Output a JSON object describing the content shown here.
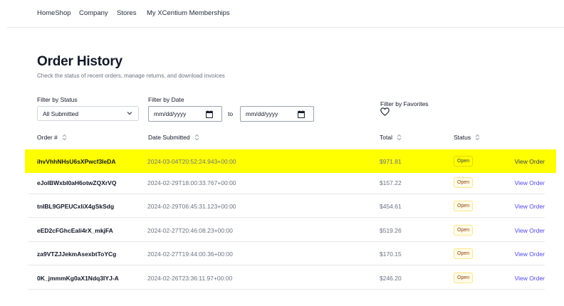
{
  "nav": {
    "items": [
      {
        "label": "HomeShop"
      },
      {
        "label": "Company"
      },
      {
        "label": "Stores"
      },
      {
        "label": "My XCentium Memberships"
      }
    ]
  },
  "header": {
    "title": "Order History",
    "subtitle": "Check the status of recent orders, manage returns, and download invoices"
  },
  "filters": {
    "status_label": "Filter by Status",
    "status_value": "All Submitted",
    "date_label": "Filter by Date",
    "date_from_placeholder": "mm/dd/yyyy",
    "date_to_placeholder": "mm/dd/yyyy",
    "to_label": "to",
    "favorites_label": "Filter by Favorites"
  },
  "table": {
    "columns": {
      "order": "Order #",
      "date": "Date Submitted",
      "total": "Total",
      "status": "Status"
    },
    "view_label": "View Order",
    "rows": [
      {
        "order": "ihvVhhNHsU6sXPwcf3IeDA",
        "date": "2024-03-04T20:52:24.943+00:00",
        "total": "$971.81",
        "status": "Open"
      },
      {
        "order": "eJoIBWxbI0aH6otwZQXrVQ",
        "date": "2024-02-29T18:00:33.767+00:00",
        "total": "$157.22",
        "status": "Open"
      },
      {
        "order": "tnIBL9GPEUCxliX4gSkSdg",
        "date": "2024-02-29T06:45:31.123+00:00",
        "total": "$454.61",
        "status": "Open"
      },
      {
        "order": "eED2cFGhcEali4rX_mkjFA",
        "date": "2024-02-27T20:46:08.23+00:00",
        "total": "$519.26",
        "status": "Open"
      },
      {
        "order": "za9VTZJJekmAsexbtToYCg",
        "date": "2024-02-27T19:44:00.36+00:00",
        "total": "$170.15",
        "status": "Open"
      },
      {
        "order": "0K_jmmmKg0aX1Ndq3IYJ-A",
        "date": "2024-02-26T23:36:11.97+00:00",
        "total": "$246.20",
        "status": "Open"
      }
    ]
  }
}
